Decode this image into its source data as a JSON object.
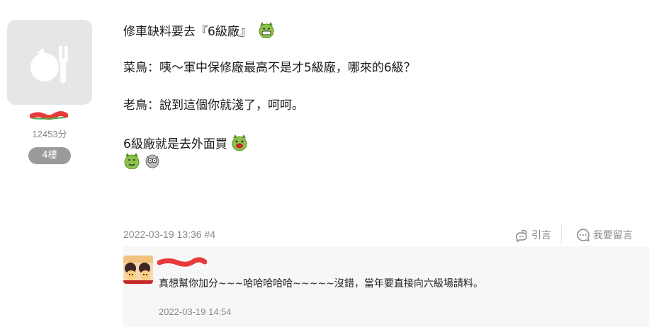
{
  "author": {
    "points": "12453分",
    "floor_badge": "4樓"
  },
  "post": {
    "lines": [
      "修車缺料要去『6級廠』",
      "菜鳥：咦～軍中保修廠最高不是才5級廠，哪來的6級？",
      "老鳥：說到這個你就淺了，呵呵。",
      "6級廠就是去外面買"
    ],
    "timestamp": "2022-03-19 13:36 #4"
  },
  "actions": {
    "quote_label": "引言",
    "reply_label": "我要留言"
  },
  "comment": {
    "text": "真想幫你加分~~~哈哈哈哈哈~~~~~沒錯，當年要直接向六級場請料。",
    "timestamp": "2022-03-19 14:54"
  },
  "colors": {
    "scribble": "#e83a3a",
    "scribble_green": "#4caf50",
    "badge_bg": "#9a9a9a",
    "emoji_green": "#8bc34a"
  }
}
